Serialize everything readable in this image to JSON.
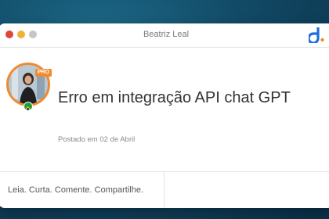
{
  "window": {
    "title": "Beatriz Leal"
  },
  "post": {
    "title": "Erro em integração API chat GPT",
    "date": "Postado em 02 de Abril",
    "badge": "PRO"
  },
  "footer": {
    "tagline": "Leia. Curta. Comente. Compartilhe."
  },
  "colors": {
    "background": "#124a66",
    "avatar_ring": "#f08a2e",
    "brand_blue": "#1e6fd9",
    "brand_orange": "#f08a2e"
  },
  "icons": {
    "brand": "brand-logo-icon",
    "flag": "brazil-flag-icon"
  }
}
